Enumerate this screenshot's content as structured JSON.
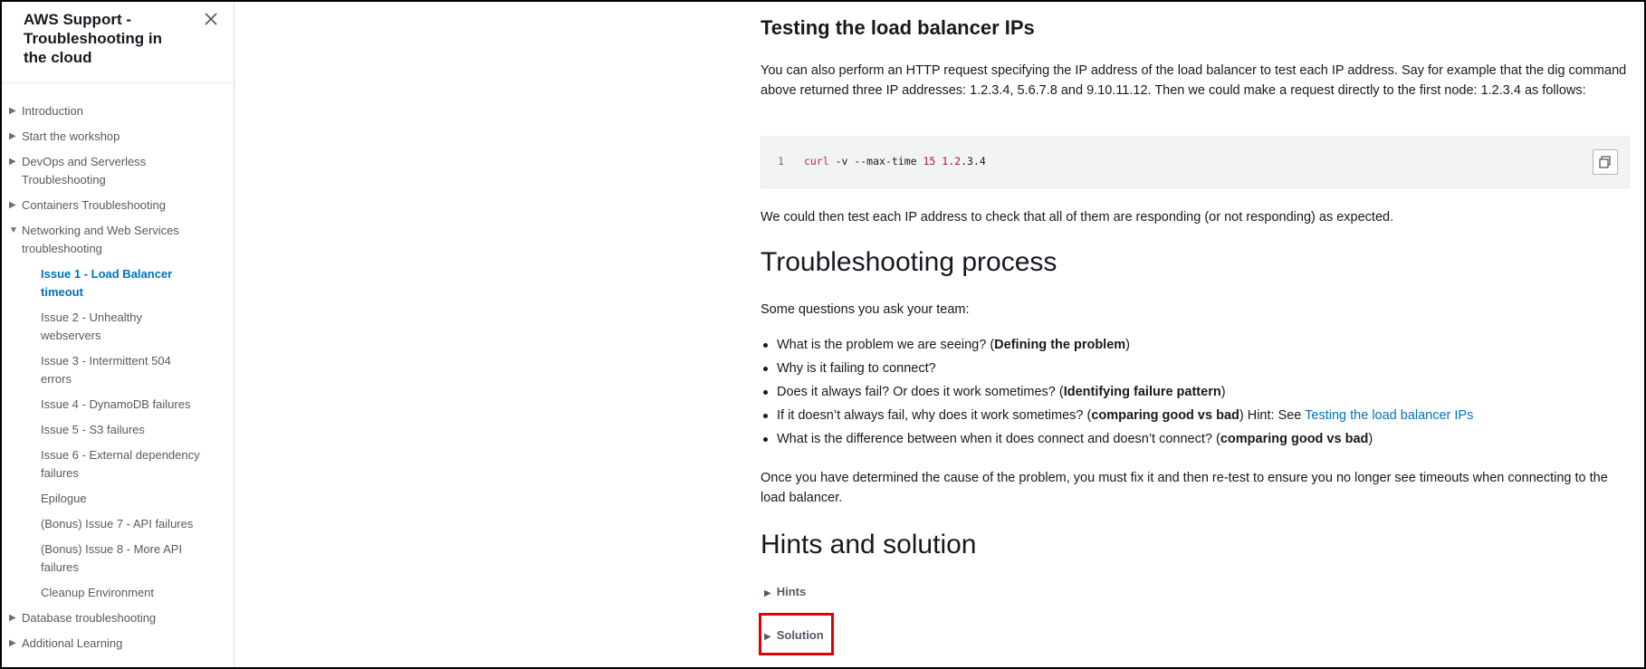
{
  "sidebar": {
    "title": "AWS Support - Troubleshooting in the cloud",
    "items": [
      {
        "label": "Introduction",
        "arrow": "▶"
      },
      {
        "label": "Start the workshop",
        "arrow": "▶"
      },
      {
        "label": "DevOps and Serverless Troubleshooting",
        "arrow": "▶"
      },
      {
        "label": "Containers Troubleshooting",
        "arrow": "▶"
      },
      {
        "label": "Networking and Web Services troubleshooting",
        "arrow": "▼"
      },
      {
        "label": "Issue 1 - Load Balancer timeout"
      },
      {
        "label": "Issue 2 - Unhealthy webservers"
      },
      {
        "label": "Issue 3 - Intermittent 504 errors"
      },
      {
        "label": "Issue 4 - DynamoDB failures"
      },
      {
        "label": "Issue 5 - S3 failures"
      },
      {
        "label": "Issue 6 - External dependency failures"
      },
      {
        "label": "Epilogue"
      },
      {
        "label": "(Bonus) Issue 7 - API failures"
      },
      {
        "label": "(Bonus) Issue 8 - More API failures"
      },
      {
        "label": "Cleanup Environment"
      },
      {
        "label": "Database troubleshooting",
        "arrow": "▶"
      },
      {
        "label": "Additional Learning",
        "arrow": "▶"
      }
    ]
  },
  "main": {
    "section_title": "Testing the load balancer IPs",
    "intro": "You can also perform an HTTP request specifying the IP address of the load balancer to test each IP address. Say for example that the dig command above returned three IP addresses: 1.2.3.4, 5.6.7.8 and 9.10.11.12. Then we could make a request directly to the first node: 1.2.3.4 as follows:",
    "code": {
      "line_number": "1",
      "cmd": "curl",
      "args": " -v --max-time ",
      "num": "15",
      "ip_a": " 1.2",
      "ip_b": ".3.4"
    },
    "after_code": "We could then test each IP address to check that all of them are responding (or not responding) as expected.",
    "troubleshooting_title": "Troubleshooting process",
    "troubleshooting_intro": "Some questions you ask your team:",
    "bullets": [
      {
        "text": "What is the problem we are seeing? (",
        "bold": "Defining the problem",
        "tail": ")"
      },
      {
        "text": "Why is it failing to connect?"
      },
      {
        "text": "Does it always fail? Or does it work sometimes? (",
        "bold": "Identifying failure pattern",
        "tail": ")"
      },
      {
        "text": "If it doesn’t always fail, why does it work sometimes? (",
        "bold": "comparing good vs bad",
        "tail": ") Hint: See ",
        "link": "Testing the load balancer IPs"
      },
      {
        "text": "What is the difference between when it does connect and doesn’t connect? (",
        "bold": "comparing good vs bad",
        "tail": ")"
      }
    ],
    "closing": "Once you have determined the cause of the problem, you must fix it and then re-test to ensure you no longer see timeouts when connecting to the load balancer.",
    "hints_title": "Hints and solution",
    "expanders": [
      {
        "label": "Hints",
        "arrow": "▶"
      },
      {
        "label": "Solution",
        "arrow": "▶"
      }
    ]
  },
  "colors": {
    "link": "#0073bb",
    "highlight": "#e00000"
  },
  "icons": {
    "close": "close-icon",
    "copy": "copy-icon",
    "expand": "caret-right-icon"
  }
}
